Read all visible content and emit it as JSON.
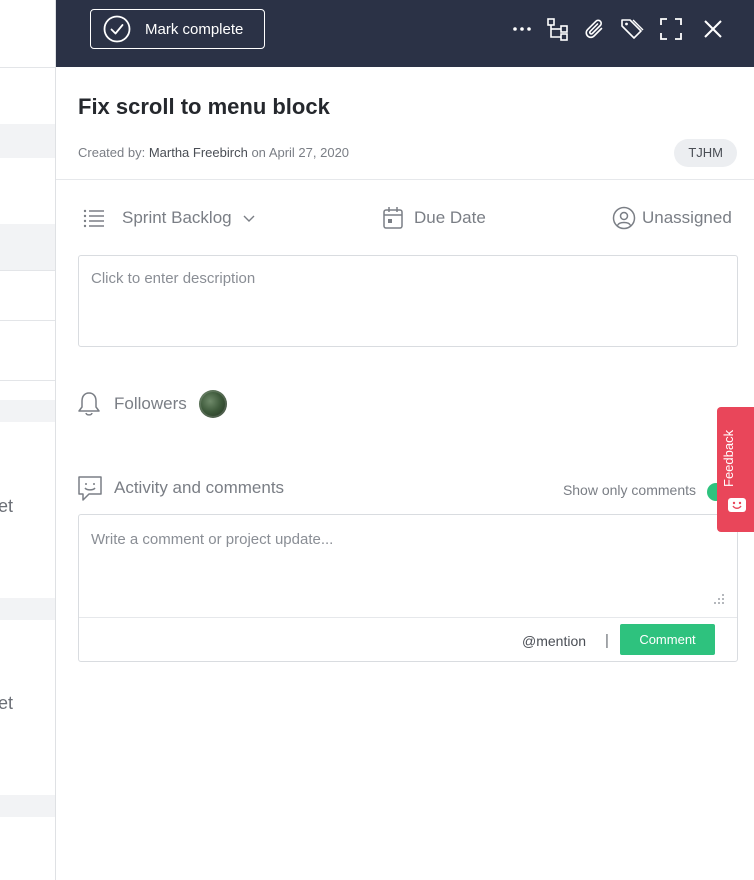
{
  "background": {
    "partial_texts": [
      "et",
      "et"
    ]
  },
  "toolbar": {
    "mark_complete_label": "Mark complete",
    "icons": [
      "more-icon",
      "subtask-icon",
      "attachment-icon",
      "tag-icon",
      "expand-icon",
      "close-icon"
    ]
  },
  "task": {
    "title": "Fix scroll to menu block",
    "created_by_label": "Created by:",
    "created_by_name": "Martha Freebirch",
    "created_on_label": "on",
    "created_date": "April 27, 2020",
    "tag": "TJHM"
  },
  "properties": {
    "list_label": "Sprint Backlog",
    "due_date_label": "Due Date",
    "assignee_label": "Unassigned"
  },
  "description": {
    "placeholder": "Click to enter description"
  },
  "followers": {
    "label": "Followers"
  },
  "activity": {
    "label": "Activity and comments",
    "show_only_comments": "Show only comments",
    "comment_placeholder": "Write a comment or project update...",
    "mention_label": "@mention",
    "separator": "|",
    "comment_button": "Comment"
  },
  "feedback": {
    "label": "Feedback"
  },
  "colors": {
    "topbar": "#2b3246",
    "accent_green": "#2ec27e",
    "feedback_red": "#e9465a"
  }
}
